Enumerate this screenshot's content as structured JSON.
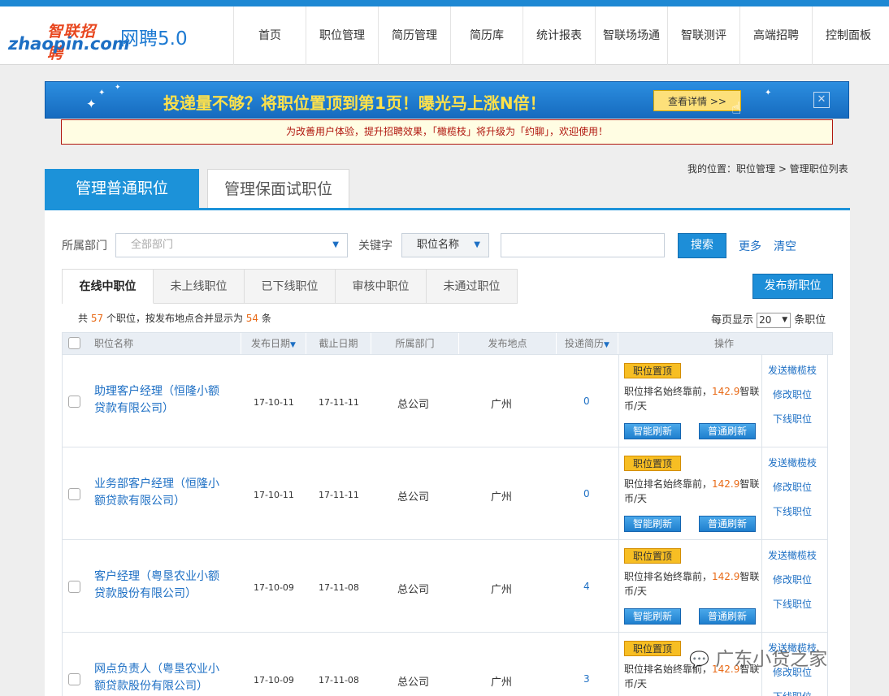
{
  "header": {
    "logo_cn": "智联招聘",
    "logo_en": "zhaopin.com",
    "product": "网聘5.0",
    "nav": [
      "首页",
      "职位管理",
      "简历管理",
      "简历库",
      "统计报表",
      "智联场场通",
      "智联测评",
      "高端招聘",
      "控制面板"
    ]
  },
  "banner": {
    "text": "投递量不够？将职位置顶到第1页！曝光马上涨N倍！",
    "button": "查看详情 >>",
    "close": "✕"
  },
  "notice": "为改善用户体验，提升招聘效果，「橄榄枝」将升级为「约聊」，欢迎使用！",
  "breadcrumb": "我的位置：职位管理 > 管理职位列表",
  "tabs": {
    "active": "管理普通职位",
    "other": "管理保面试职位"
  },
  "filters": {
    "dept_label": "所属部门",
    "dept_value": "全部部门",
    "keyword_label": "关键字",
    "keyword_type": "职位名称",
    "keyword_value": "",
    "search": "搜索",
    "more": "更多",
    "clear": "清空"
  },
  "subtabs": [
    "在线中职位",
    "未上线职位",
    "已下线职位",
    "审核中职位",
    "未通过职位"
  ],
  "publish_button": "发布新职位",
  "summary": {
    "prefix": "共",
    "count": "57",
    "mid": "个职位，按发布地点合并显示为",
    "merged": "54",
    "suffix": "条"
  },
  "per_page": {
    "prefix": "每页显示",
    "value": "20",
    "suffix": "条职位"
  },
  "columns": [
    "职位名称",
    "发布日期",
    "截止日期",
    "所属部门",
    "发布地点",
    "投递简历",
    "操作"
  ],
  "rows": [
    {
      "title": "助理客户经理（恒隆小额贷款有限公司）",
      "pub": "17-10-11",
      "end": "17-11-11",
      "dept": "总公司",
      "loc": "广州",
      "resumes": "0"
    },
    {
      "title": "业务部客户经理（恒隆小额贷款有限公司）",
      "pub": "17-10-11",
      "end": "17-11-11",
      "dept": "总公司",
      "loc": "广州",
      "resumes": "0"
    },
    {
      "title": "客户经理（粤垦农业小额贷款股份有限公司）",
      "pub": "17-10-09",
      "end": "17-11-08",
      "dept": "总公司",
      "loc": "广州",
      "resumes": "4"
    },
    {
      "title": "网点负责人（粤垦农业小额贷款股份有限公司）",
      "pub": "17-10-09",
      "end": "17-11-08",
      "dept": "总公司",
      "loc": "广州",
      "resumes": "3"
    }
  ],
  "ops": {
    "top_badge": "职位置顶",
    "rank_text_a": "职位排名始终靠前，",
    "rank_price": "142.9",
    "rank_text_b": "智联币/天",
    "smart_refresh": "智能刷新",
    "normal_refresh": "普通刷新",
    "send": "发送橄榄枝",
    "edit": "修改职位",
    "offline": "下线职位"
  },
  "watermark": "广东小贷之家",
  "colors": {
    "brand_blue": "#1c92d9",
    "highlight": "#e86a17",
    "link": "#1d6fc4"
  }
}
